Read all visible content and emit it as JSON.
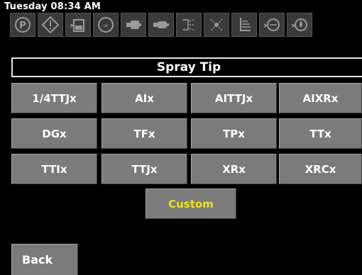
{
  "status": {
    "datetime": "Tuesday 08:34 AM"
  },
  "toolbar": {
    "icons": [
      "parking-icon",
      "warning-icon",
      "tank-level-icon",
      "tank-icon",
      "pump-icon",
      "pump-alt-icon",
      "nozzle-icon",
      "spray-nozzle-icon",
      "boom-spray-icon",
      "flow-meter-icon",
      "droplet-valve-icon"
    ]
  },
  "screen": {
    "title": "Spray Tip"
  },
  "tips": [
    [
      "1/4TTJx",
      "AIx",
      "AITTJx",
      "AIXRx"
    ],
    [
      "DGx",
      "TFx",
      "TPx",
      "TTx"
    ],
    [
      "TTIx",
      "TTJx",
      "XRx",
      "XRCx"
    ]
  ],
  "custom_label": "Custom",
  "back_label": "Back",
  "colors": {
    "accent_yellow": "#f2e21a",
    "button_gray": "#7b7b7b",
    "background": "#000000"
  }
}
